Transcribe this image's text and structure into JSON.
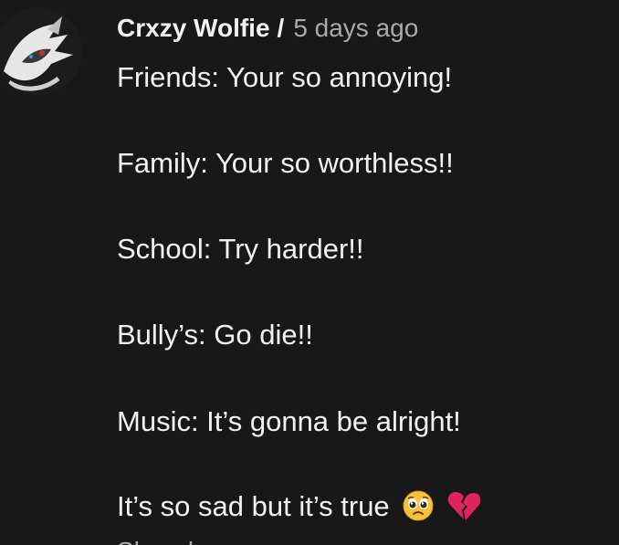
{
  "comment": {
    "author": "Crxzy Wolfie",
    "separator": "/",
    "timestamp": "5 days ago",
    "lines": [
      "Friends: Your so annoying!",
      "Family: Your so worthless!!",
      "School: Try harder!!",
      "Bully’s: Go die!!",
      "Music: It’s gonna be alright!",
      "It’s so sad but it’s true"
    ],
    "emojis": [
      "pleading-face-icon",
      "broken-heart-icon"
    ],
    "show_more_label": "Show less"
  },
  "colors": {
    "background": "#181818",
    "text": "#f1f1f1",
    "secondary": "#aaaaaa"
  }
}
